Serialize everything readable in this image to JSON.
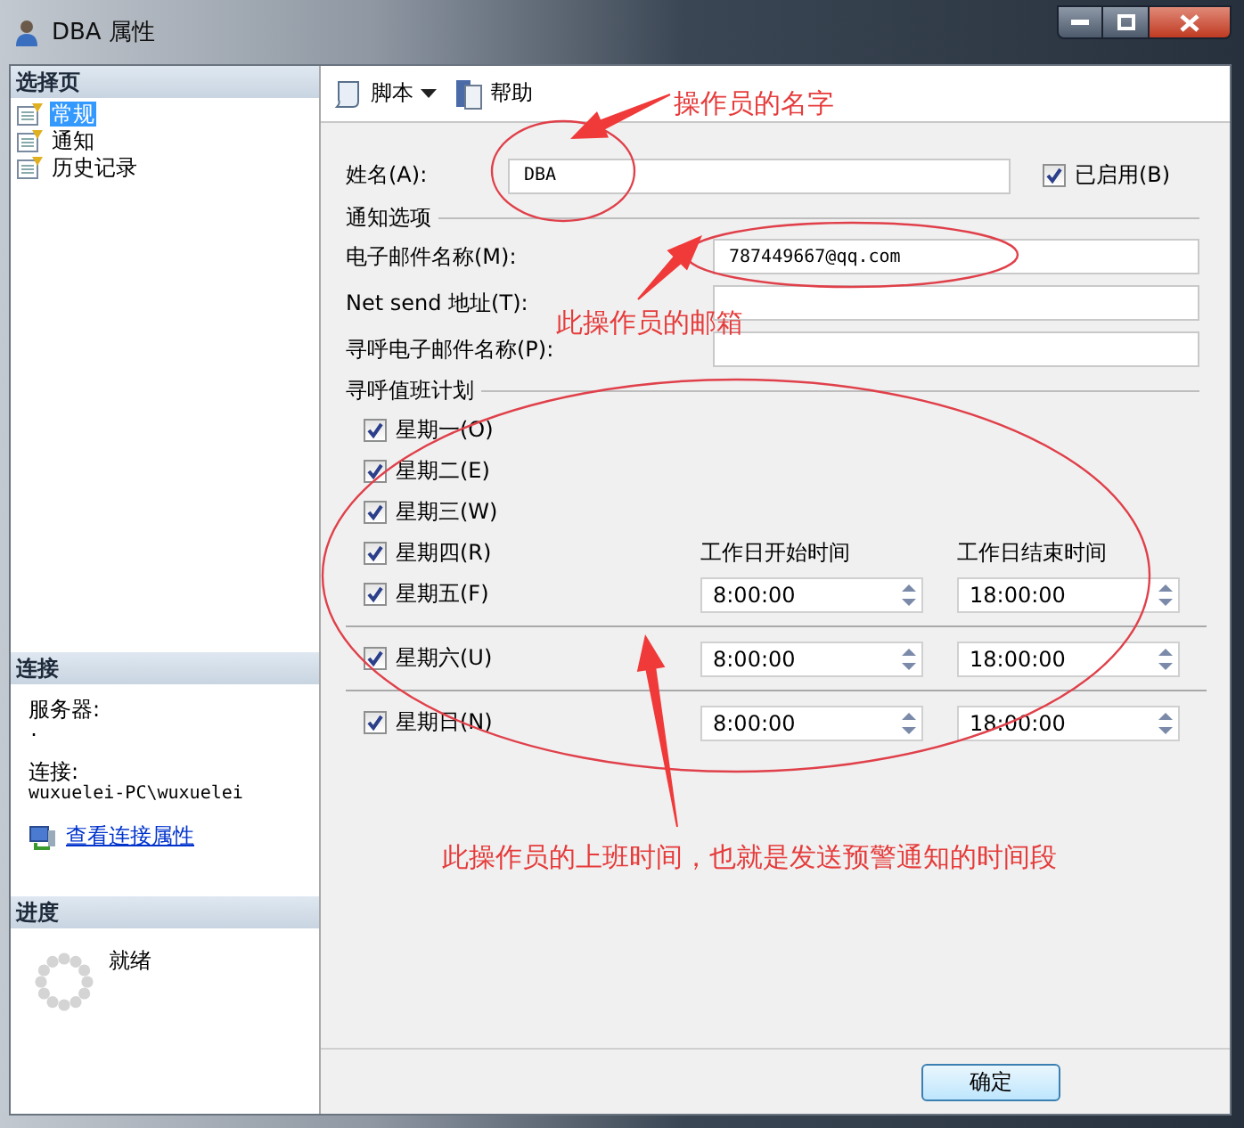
{
  "window": {
    "title": "DBA 属性"
  },
  "sidebar": {
    "select_page": {
      "header": "选择页",
      "items": [
        {
          "label": "常规",
          "selected": true
        },
        {
          "label": "通知",
          "selected": false
        },
        {
          "label": "历史记录",
          "selected": false
        }
      ]
    },
    "connection": {
      "header": "连接",
      "server_label": "服务器:",
      "server_value": ".",
      "connection_label": "连接:",
      "connection_value": "wuxuelei-PC\\wuxuelei",
      "link": "查看连接属性"
    },
    "progress": {
      "header": "进度",
      "status": "就绪"
    }
  },
  "toolbar": [
    {
      "label": "脚本",
      "kind": "dropdown"
    },
    {
      "label": "帮助",
      "kind": "help"
    }
  ],
  "form": {
    "name": {
      "label": "姓名(A):",
      "value": "DBA"
    },
    "enabled": {
      "label": "已启用(B)",
      "checked": true
    },
    "notify_section": "通知选项",
    "fields": [
      {
        "label": "电子邮件名称(M):",
        "value": "787449667@qq.com"
      },
      {
        "label": "Net send 地址(T):"
      },
      {
        "label": "寻呼电子邮件名称(P):"
      }
    ],
    "schedule": {
      "title": "寻呼值班计划",
      "start_header": "工作日开始时间",
      "end_header": "工作日结束时间",
      "days": [
        {
          "label": "星期一(O)",
          "checked": true
        },
        {
          "label": "星期二(E)",
          "checked": true
        },
        {
          "label": "星期三(W)",
          "checked": true
        },
        {
          "label": "星期四(R)",
          "checked": true
        },
        {
          "label": "星期五(F)",
          "checked": true,
          "start": "8:00:00",
          "end": "18:00:00"
        },
        {
          "label": "星期六(U)",
          "checked": true,
          "start": "8:00:00",
          "end": "18:00:00"
        },
        {
          "label": "星期日(N)",
          "checked": true,
          "start": "8:00:00",
          "end": "18:00:00"
        }
      ]
    }
  },
  "buttons": [
    "确定"
  ],
  "annotations": [
    {
      "text": "操作员的名字"
    },
    {
      "text": "此操作员的邮箱"
    },
    {
      "text": "此操作员的上班时间，也就是发送预警通知的时间段"
    }
  ]
}
